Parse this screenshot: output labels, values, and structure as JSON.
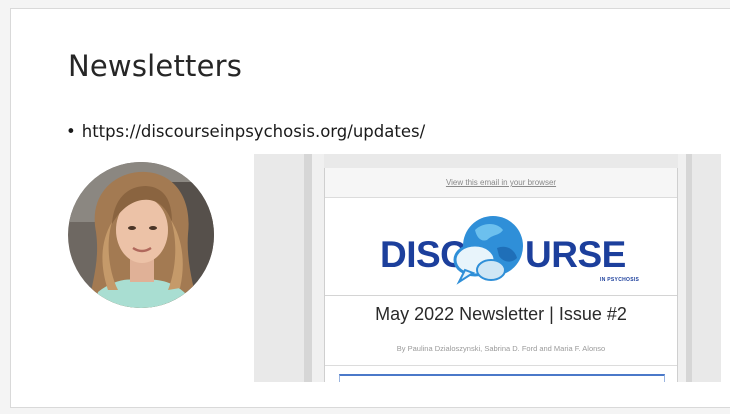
{
  "slide": {
    "title": "Newsletters",
    "bullet": "https://discourseinpsychosis.org/updates/"
  },
  "newsletter": {
    "view_link": "View this email in your browser",
    "logo_left": "DISC",
    "logo_right": "URSE",
    "logo_sub": "IN PSYCHOSIS",
    "headline": "May 2022 Newsletter | Issue #2",
    "byline": "By Paulina Dzialoszynski, Sabrina D. Ford and Maria F. Alonso"
  },
  "colors": {
    "logo_blue": "#1c3f9c",
    "globe_blue": "#2f8fd8",
    "accent_border": "#4b79c9"
  }
}
